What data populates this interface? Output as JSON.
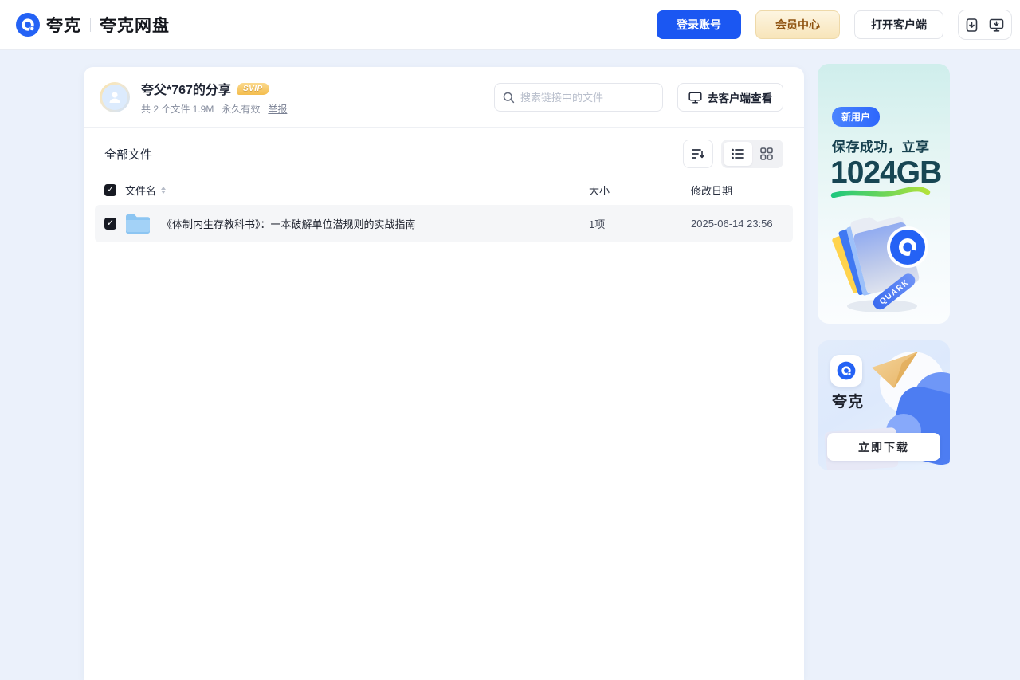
{
  "header": {
    "logo_text": "夸克",
    "logo_subtext": "夸克网盘",
    "login_button": "登录账号",
    "vip_button": "会员中心",
    "open_client_button": "打开客户端"
  },
  "share": {
    "title": "夸父*767的分享",
    "badge": "SVIP",
    "meta_files": "共 2 个文件 1.9M",
    "meta_valid": "永久有效",
    "report_link": "举报",
    "search_placeholder": "搜索链接中的文件",
    "view_in_client_button": "去客户端查看"
  },
  "files": {
    "section_title": "全部文件",
    "columns": {
      "name": "文件名",
      "size": "大小",
      "modified": "修改日期"
    },
    "rows": [
      {
        "name": "《体制内生存教科书》：一本破解单位潜规则的实战指南",
        "size": "1项",
        "modified": "2025-06-14 23:56",
        "type": "folder",
        "checked": true
      }
    ]
  },
  "promo_top": {
    "badge": "新用户",
    "line1": "保存成功，立享",
    "line2": "1024GB",
    "ribbon": "QUARK"
  },
  "promo_bottom": {
    "app_name": "夸克",
    "download_button": "立即下载"
  },
  "icons": {
    "logo": "quark-circle",
    "search": "magnifier",
    "monitor": "desktop-display",
    "phone_download": "mobile-with-down-arrow",
    "desktop_download": "monitor-with-down-arrow",
    "sort": "lines-with-down-arrow",
    "list_view": "list-bullets",
    "grid_view": "four-squares",
    "checkbox_check": "✓",
    "folder": "blue-folder",
    "avatar": "person-silhouette"
  },
  "colors": {
    "brand_blue": "#1b57f2",
    "vip_gold_text": "#8f5310",
    "page_bg": "#ebf1fb",
    "card_bg": "#ffffff",
    "row_bg": "#f5f6f8",
    "promo_teal_text": "#174653",
    "swoosh_green": "#2bc986",
    "checkbox_dark": "#171a23"
  }
}
